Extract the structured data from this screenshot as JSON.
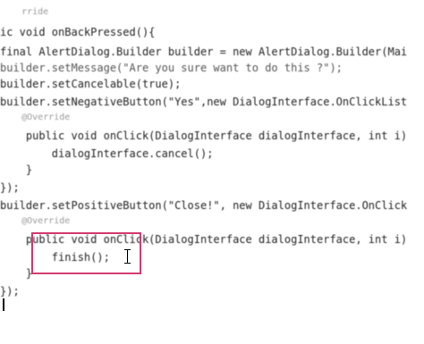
{
  "code_lines": [
    "    rride",
    "ic void onBackPressed(){",
    "final AlertDialog.Builder builder = new AlertDialog.Builder(Mai",
    "builder.setMessage(\"Are you sure want to do this ?\");",
    "builder.setCancelable(true);",
    "builder.setNegativeButton(\"Yes\",new DialogInterface.OnClickList",
    "    @Override",
    "    public void onClick(DialogInterface dialogInterface, int i)",
    "        dialogInterface.cancel();",
    "    }",
    "});",
    "builder.setPositiveButton(\"Close!\", new DialogInterface.OnClick",
    "    @Override",
    "    public void onClick(DialogInterface dialogInterface, int i)",
    "        finish();",
    "    }",
    "});",
    ""
  ]
}
